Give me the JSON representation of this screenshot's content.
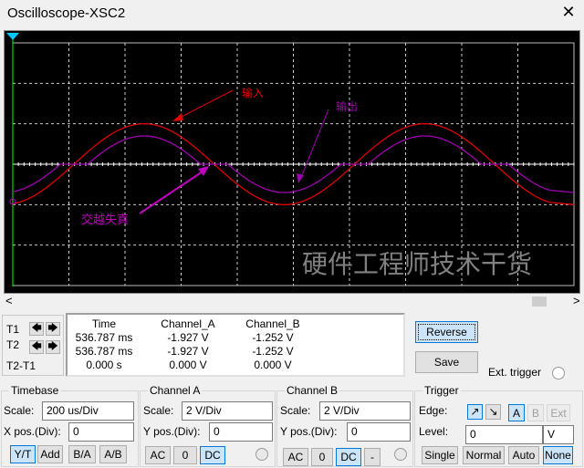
{
  "window": {
    "title": "Oscilloscope-XSC2",
    "close": "✕"
  },
  "screen": {
    "annotations": {
      "input": "输入",
      "output": "输出",
      "crossover": "交越失真"
    },
    "watermark": "硬件工程师技术干货",
    "trigger_marker": "T"
  },
  "chart_data": {
    "type": "line",
    "title": "",
    "x_unit": "ms",
    "y_unit": "V",
    "time_per_div_us": 200,
    "volts_per_div": 2,
    "x_divisions": 10,
    "y_divisions": 6,
    "grid": true,
    "series": [
      {
        "name": "Channel_A (输入)",
        "color": "#e00000",
        "shape": "sine",
        "amplitude_v": 2.0,
        "period_ms": 1.0,
        "offset_v": 0
      },
      {
        "name": "Channel_B (输出)",
        "color": "#b000b0",
        "shape": "sine with crossover dead zone",
        "amplitude_v": 1.4,
        "dead_zone_v": 0.6,
        "period_ms": 1.0,
        "offset_v": 0
      }
    ]
  },
  "scrollbar": {
    "left": "<",
    "right": ">"
  },
  "cursors": {
    "t1": "T1",
    "t2": "T2",
    "diff": "T2-T1",
    "left": "🡄",
    "right": "🡆"
  },
  "readout": {
    "headers": [
      "Time",
      "Channel_A",
      "Channel_B"
    ],
    "rows": [
      [
        "536.787 ms",
        "-1.927 V",
        "-1.252 V"
      ],
      [
        "536.787 ms",
        "-1.927 V",
        "-1.252 V"
      ],
      [
        "0.000 s",
        "0.000 V",
        "0.000 V"
      ]
    ]
  },
  "buttons": {
    "reverse": "Reverse",
    "save": "Save",
    "ext_trigger": "Ext. trigger"
  },
  "timebase": {
    "title": "Timebase",
    "scale_label": "Scale:",
    "scale": "200 us/Div",
    "pos_label": "X pos.(Div):",
    "pos": "0",
    "modes": [
      "Y/T",
      "Add",
      "B/A",
      "A/B"
    ]
  },
  "channel_a": {
    "title": "Channel A",
    "scale_label": "Scale:",
    "scale": "2  V/Div",
    "pos_label": "Y pos.(Div):",
    "pos": "0",
    "coupling": [
      "AC",
      "0",
      "DC"
    ]
  },
  "channel_b": {
    "title": "Channel B",
    "scale_label": "Scale:",
    "scale": "2  V/Div",
    "pos_label": "Y pos.(Div):",
    "pos": "0",
    "coupling": [
      "AC",
      "0",
      "DC",
      "-"
    ]
  },
  "trigger": {
    "title": "Trigger",
    "edge_label": "Edge:",
    "edges": [
      "↗",
      "↘"
    ],
    "sources": [
      "A",
      "B",
      "Ext"
    ],
    "level_label": "Level:",
    "level": "0",
    "level_unit": "V",
    "modes": [
      "Single",
      "Normal",
      "Auto",
      "None"
    ]
  }
}
